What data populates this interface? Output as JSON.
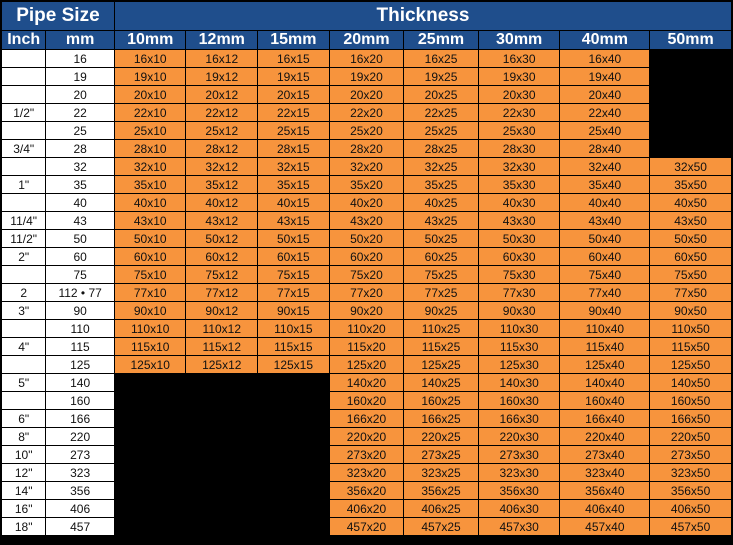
{
  "header": {
    "pipe_size": "Pipe Size",
    "thickness": "Thickness",
    "inch": "Inch",
    "mm": "mm",
    "thicknesses": [
      "10mm",
      "12mm",
      "15mm",
      "20mm",
      "25mm",
      "30mm",
      "40mm",
      "50mm"
    ]
  },
  "colors": {
    "header_bg": "#1f4e8c",
    "cell_bg": "#f7943d",
    "blank_bg": "#000000",
    "size_bg": "#ffffff"
  },
  "rows": [
    {
      "inch": "",
      "mm": "16",
      "cells": [
        "16x10",
        "16x12",
        "16x15",
        "16x20",
        "16x25",
        "16x30",
        "16x40",
        null
      ]
    },
    {
      "inch": "",
      "mm": "19",
      "cells": [
        "19x10",
        "19x12",
        "19x15",
        "19x20",
        "19x25",
        "19x30",
        "19x40",
        null
      ]
    },
    {
      "inch": "",
      "mm": "20",
      "cells": [
        "20x10",
        "20x12",
        "20x15",
        "20x20",
        "20x25",
        "20x30",
        "20x40",
        null
      ]
    },
    {
      "inch": "1/2\"",
      "mm": "22",
      "cells": [
        "22x10",
        "22x12",
        "22x15",
        "22x20",
        "22x25",
        "22x30",
        "22x40",
        null
      ]
    },
    {
      "inch": "",
      "mm": "25",
      "cells": [
        "25x10",
        "25x12",
        "25x15",
        "25x20",
        "25x25",
        "25x30",
        "25x40",
        null
      ]
    },
    {
      "inch": "3/4\"",
      "mm": "28",
      "cells": [
        "28x10",
        "28x12",
        "28x15",
        "28x20",
        "28x25",
        "28x30",
        "28x40",
        null
      ]
    },
    {
      "inch": "",
      "mm": "32",
      "cells": [
        "32x10",
        "32x12",
        "32x15",
        "32x20",
        "32x25",
        "32x30",
        "32x40",
        "32x50"
      ]
    },
    {
      "inch": "1\"",
      "mm": "35",
      "cells": [
        "35x10",
        "35x12",
        "35x15",
        "35x20",
        "35x25",
        "35x30",
        "35x40",
        "35x50"
      ]
    },
    {
      "inch": "",
      "mm": "40",
      "cells": [
        "40x10",
        "40x12",
        "40x15",
        "40x20",
        "40x25",
        "40x30",
        "40x40",
        "40x50"
      ]
    },
    {
      "inch": "11/4\"",
      "mm": "43",
      "cells": [
        "43x10",
        "43x12",
        "43x15",
        "43x20",
        "43x25",
        "43x30",
        "43x40",
        "43x50"
      ]
    },
    {
      "inch": "11/2\"",
      "mm": "50",
      "cells": [
        "50x10",
        "50x12",
        "50x15",
        "50x20",
        "50x25",
        "50x30",
        "50x40",
        "50x50"
      ]
    },
    {
      "inch": "2\"",
      "mm": "60",
      "cells": [
        "60x10",
        "60x12",
        "60x15",
        "60x20",
        "60x25",
        "60x30",
        "60x40",
        "60x50"
      ]
    },
    {
      "inch": "",
      "mm": "75",
      "cells": [
        "75x10",
        "75x12",
        "75x15",
        "75x20",
        "75x25",
        "75x30",
        "75x40",
        "75x50"
      ]
    },
    {
      "inch": "2",
      "mm": "112 • 77",
      "cells": [
        "77x10",
        "77x12",
        "77x15",
        "77x20",
        "77x25",
        "77x30",
        "77x40",
        "77x50"
      ]
    },
    {
      "inch": "3\"",
      "mm": "90",
      "cells": [
        "90x10",
        "90x12",
        "90x15",
        "90x20",
        "90x25",
        "90x30",
        "90x40",
        "90x50"
      ]
    },
    {
      "inch": "",
      "mm": "110",
      "cells": [
        "110x10",
        "110x12",
        "110x15",
        "110x20",
        "110x25",
        "110x30",
        "110x40",
        "110x50"
      ]
    },
    {
      "inch": "4\"",
      "mm": "115",
      "cells": [
        "115x10",
        "115x12",
        "115x15",
        "115x20",
        "115x25",
        "115x30",
        "115x40",
        "115x50"
      ]
    },
    {
      "inch": "",
      "mm": "125",
      "cells": [
        "125x10",
        "125x12",
        "125x15",
        "125x20",
        "125x25",
        "125x30",
        "125x40",
        "125x50"
      ]
    },
    {
      "inch": "5\"",
      "mm": "140",
      "cells": [
        null,
        null,
        null,
        "140x20",
        "140x25",
        "140x30",
        "140x40",
        "140x50"
      ]
    },
    {
      "inch": "",
      "mm": "160",
      "cells": [
        null,
        null,
        null,
        "160x20",
        "160x25",
        "160x30",
        "160x40",
        "160x50"
      ]
    },
    {
      "inch": "6\"",
      "mm": "166",
      "cells": [
        null,
        null,
        null,
        "166x20",
        "166x25",
        "166x30",
        "166x40",
        "166x50"
      ]
    },
    {
      "inch": "8\"",
      "mm": "220",
      "cells": [
        null,
        null,
        null,
        "220x20",
        "220x25",
        "220x30",
        "220x40",
        "220x50"
      ]
    },
    {
      "inch": "10\"",
      "mm": "273",
      "cells": [
        null,
        null,
        null,
        "273x20",
        "273x25",
        "273x30",
        "273x40",
        "273x50"
      ]
    },
    {
      "inch": "12\"",
      "mm": "323",
      "cells": [
        null,
        null,
        null,
        "323x20",
        "323x25",
        "323x30",
        "323x40",
        "323x50"
      ]
    },
    {
      "inch": "14\"",
      "mm": "356",
      "cells": [
        null,
        null,
        null,
        "356x20",
        "356x25",
        "356x30",
        "356x40",
        "356x50"
      ]
    },
    {
      "inch": "16\"",
      "mm": "406",
      "cells": [
        null,
        null,
        null,
        "406x20",
        "406x25",
        "406x30",
        "406x40",
        "406x50"
      ]
    },
    {
      "inch": "18\"",
      "mm": "457",
      "cells": [
        null,
        null,
        null,
        "457x20",
        "457x25",
        "457x30",
        "457x40",
        "457x50"
      ]
    }
  ]
}
